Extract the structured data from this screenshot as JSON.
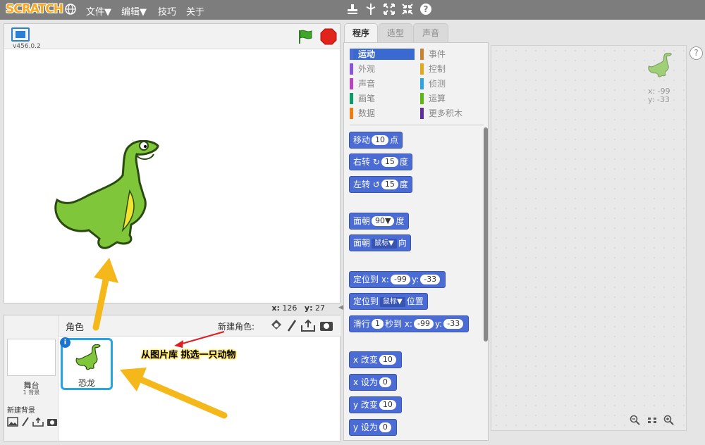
{
  "menubar": {
    "logo": "SCRATCH",
    "menus": [
      "文件▼",
      "编辑▼",
      "技巧",
      "关于"
    ],
    "tools": [
      "stamp-icon",
      "cut-icon",
      "grow-icon",
      "shrink-icon",
      "help-icon"
    ],
    "help_glyph": "?"
  },
  "stage": {
    "version": "v456.0.2",
    "x_label": "x:",
    "x_value": "126",
    "y_label": "y:",
    "y_value": "27"
  },
  "sprites": {
    "heading": "角色",
    "new_sprite": "新建角色:",
    "stage_label": "舞台",
    "backdrop_count": "1 背景",
    "new_backdrop": "新建背景",
    "sprite_name": "恐龙"
  },
  "tabs": [
    "程序",
    "造型",
    "声音"
  ],
  "categories": [
    {
      "label": "运动",
      "color": "#4a6cd4"
    },
    {
      "label": "事件",
      "color": "#c88330"
    },
    {
      "label": "外观",
      "color": "#8a55d7"
    },
    {
      "label": "控制",
      "color": "#e1a91a"
    },
    {
      "label": "声音",
      "color": "#bb42c3"
    },
    {
      "label": "侦测",
      "color": "#2ca5e2"
    },
    {
      "label": "画笔",
      "color": "#0e9a6c"
    },
    {
      "label": "运算",
      "color": "#5cb712"
    },
    {
      "label": "数据",
      "color": "#ee7d16"
    },
    {
      "label": "更多积木",
      "color": "#632d99"
    }
  ],
  "blocks": {
    "move": {
      "label": "移动",
      "num": "10",
      "unit": "点"
    },
    "turn_right": {
      "label": "右转",
      "num": "15",
      "unit": "度"
    },
    "turn_left": {
      "label": "左转",
      "num": "15",
      "unit": "度"
    },
    "point_dir": {
      "label": "面朝",
      "num": "90▼",
      "unit": "度"
    },
    "point_towards": {
      "label": "面朝",
      "drop": "鼠标▼",
      "unit": "向"
    },
    "goto_xy": {
      "label": "定位到 x:",
      "x": "-99",
      "ylabel": "y:",
      "y": "-33"
    },
    "goto": {
      "label": "定位到",
      "drop": "鼠标▼",
      "unit": "位置"
    },
    "glide": {
      "label": "滑行",
      "secs": "1",
      "mid": "秒到 x:",
      "x": "-99",
      "ylabel": "y:",
      "y": "-33"
    },
    "change_x": {
      "label": "x 改变",
      "num": "10"
    },
    "set_x": {
      "label": "x 设为",
      "num": "0"
    },
    "change_y": {
      "label": "y 改变",
      "num": "10"
    },
    "set_y": {
      "label": "y 设为",
      "num": "0"
    }
  },
  "scripts": {
    "x_label": "x: -99",
    "y_label": "y: -33"
  },
  "annotation": "从图片库 挑选一只动物"
}
